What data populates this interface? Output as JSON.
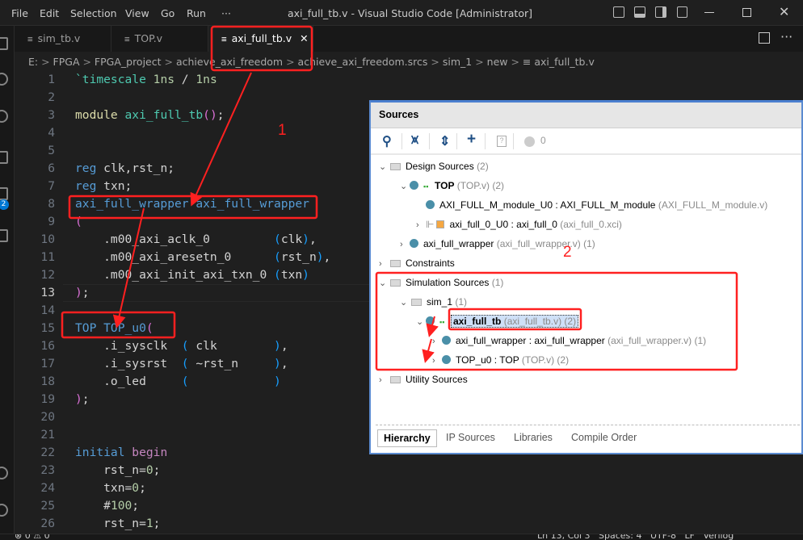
{
  "menu": [
    "File",
    "Edit",
    "Selection",
    "View",
    "Go",
    "Run",
    "···"
  ],
  "window_title": "axi_full_tb.v - Visual Studio Code [Administrator]",
  "tabs": [
    {
      "label": "sim_tb.v"
    },
    {
      "label": "TOP.v"
    },
    {
      "label": "axi_full_tb.v",
      "active": true,
      "close": "✕"
    }
  ],
  "breadcrumb": [
    "E:",
    "FPGA",
    "FPGA_project",
    "achieve_axi_freedom",
    "achieve_axi_freedom.srcs",
    "sim_1",
    "new",
    "axi_full_tb.v"
  ],
  "breadcrumb_sep": ">",
  "activity_badge": "2",
  "current_line": 13,
  "code": [
    [
      [
        "`timescale ",
        "t"
      ],
      [
        "1ns",
        "n"
      ],
      [
        " / ",
        ""
      ],
      [
        "1ns",
        "n"
      ]
    ],
    [],
    [
      [
        "module ",
        "y"
      ],
      [
        "axi_full_tb",
        "t"
      ],
      [
        "()",
        "p"
      ],
      [
        ";",
        ""
      ]
    ],
    [],
    [],
    [
      [
        "reg ",
        "k"
      ],
      [
        "clk,rst_n;",
        ""
      ]
    ],
    [
      [
        "reg ",
        "k"
      ],
      [
        "txn;",
        ""
      ]
    ],
    [
      [
        "axi_full_wrapper axi_full_wrapper",
        "k"
      ]
    ],
    [
      [
        "(",
        "p"
      ]
    ],
    [
      [
        "    .m00_axi_aclk_0         ",
        ""
      ],
      [
        "(",
        "b"
      ],
      [
        "clk",
        ""
      ],
      [
        ")",
        "b"
      ],
      [
        ",",
        ""
      ]
    ],
    [
      [
        "    .m00_axi_aresetn_0      ",
        ""
      ],
      [
        "(",
        "b"
      ],
      [
        "rst_n",
        ""
      ],
      [
        ")",
        "b"
      ],
      [
        ",",
        ""
      ]
    ],
    [
      [
        "    .m00_axi_init_axi_txn_0 ",
        ""
      ],
      [
        "(",
        "b"
      ],
      [
        "txn",
        ""
      ],
      [
        ")",
        "b"
      ]
    ],
    [
      [
        ")",
        "p"
      ],
      [
        ";",
        ""
      ]
    ],
    [],
    [
      [
        "TOP TOP_u0",
        "k"
      ],
      [
        "(",
        "p"
      ]
    ],
    [
      [
        "    .i_sysclk  ",
        ""
      ],
      [
        "(",
        "b"
      ],
      [
        " clk        ",
        ""
      ],
      [
        ")",
        "b"
      ],
      [
        ",",
        ""
      ]
    ],
    [
      [
        "    .i_sysrst  ",
        ""
      ],
      [
        "(",
        "b"
      ],
      [
        " ~rst_n     ",
        ""
      ],
      [
        ")",
        "b"
      ],
      [
        ",",
        ""
      ]
    ],
    [
      [
        "    .o_led     ",
        ""
      ],
      [
        "(",
        "b"
      ],
      [
        "            ",
        ""
      ],
      [
        ")",
        "b"
      ]
    ],
    [
      [
        ")",
        "p"
      ],
      [
        ";",
        ""
      ]
    ],
    [],
    [],
    [
      [
        "initial ",
        "k"
      ],
      [
        "begin",
        "m"
      ]
    ],
    [
      [
        "    rst_n=",
        ""
      ],
      [
        "0",
        "n"
      ],
      [
        ";",
        ""
      ]
    ],
    [
      [
        "    txn=",
        ""
      ],
      [
        "0",
        "n"
      ],
      [
        ";",
        ""
      ]
    ],
    [
      [
        "    #",
        ""
      ],
      [
        "100",
        "n"
      ],
      [
        ";",
        ""
      ]
    ],
    [
      [
        "    rst_n=",
        ""
      ],
      [
        "1",
        "n"
      ],
      [
        ";",
        ""
      ]
    ]
  ],
  "status": {
    "left": "⊗ 0 ⚠ 0",
    "right": "Ln 13, Col 3   Spaces: 4   UTF-8   LF   Verilog"
  },
  "vivado": {
    "title": "Sources",
    "warning_count": "0",
    "tree": [
      {
        "chev": "⌄",
        "icon": "folder",
        "label": "Design Sources",
        "extra": "(2)"
      },
      {
        "chev": "⌄",
        "icon": "dot-hier",
        "label": "TOP",
        "bold": true,
        "extra": "(TOP.v) (2)"
      },
      {
        "chev": "",
        "icon": "dot",
        "label": "AXI_FULL_M_module_U0 : AXI_FULL_M_module",
        "extra": "(AXI_FULL_M_module.v)"
      },
      {
        "chev": "›",
        "icon": "ip",
        "label": "axi_full_0_U0 : axi_full_0",
        "extra": "(axi_full_0.xci)"
      },
      {
        "chev": "›",
        "icon": "dot",
        "label": "axi_full_wrapper",
        "extra": "(axi_full_wrapper.v) (1)"
      },
      {
        "chev": "›",
        "icon": "folder",
        "label": "Constraints",
        "extra": ""
      },
      {
        "chev": "⌄",
        "icon": "folder",
        "label": "Simulation Sources",
        "extra": "(1)"
      },
      {
        "chev": "⌄",
        "icon": "folder",
        "label": "sim_1",
        "extra": "(1)"
      },
      {
        "chev": "⌄",
        "icon": "dot-hier",
        "label": "axi_full_tb",
        "bold": true,
        "selected": true,
        "extra": "(axi_full_tb.v) (2)"
      },
      {
        "chev": "›",
        "icon": "dot",
        "label": "axi_full_wrapper : axi_full_wrapper",
        "extra": "(axi_full_wrapper.v) (1)"
      },
      {
        "chev": "›",
        "icon": "dot",
        "label": "TOP_u0 : TOP",
        "extra": "(TOP.v) (2)"
      },
      {
        "chev": "›",
        "icon": "folder",
        "label": "Utility Sources",
        "extra": ""
      }
    ],
    "bottom_tabs": [
      "Hierarchy",
      "IP Sources",
      "Libraries",
      "Compile Order"
    ]
  },
  "annotations": {
    "label1": "1",
    "label2": "2",
    "color": "#ff2020"
  }
}
